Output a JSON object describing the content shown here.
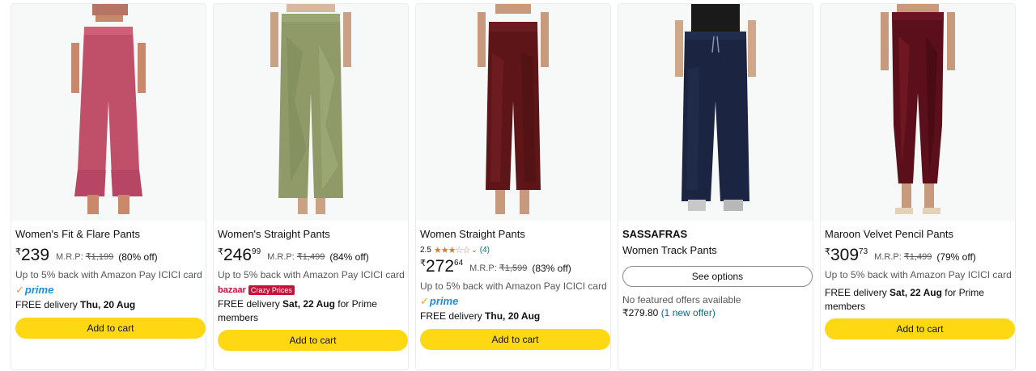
{
  "products": [
    {
      "title": "Women's Fit & Flare Pants",
      "price_symbol": "₹",
      "price_whole": "239",
      "price_fraction": "",
      "mrp_label": "M.R.P:",
      "mrp_value": "₹1,199",
      "discount": "(80% off)",
      "cashback": "Up to 5% back with Amazon Pay ICICI card",
      "prime_label": "prime",
      "delivery_prefix": "FREE delivery",
      "delivery_date": "Thu, 20 Aug",
      "button_label": "Add to cart"
    },
    {
      "title": "Women's Straight Pants",
      "price_symbol": "₹",
      "price_whole": "246",
      "price_fraction": "99",
      "mrp_label": "M.R.P:",
      "mrp_value": "₹1,499",
      "discount": "(84% off)",
      "cashback": "Up to 5% back with Amazon Pay ICICI card",
      "bazaar_label": "bazaar",
      "badge_label": "Crazy Prices",
      "delivery_prefix": "FREE delivery",
      "delivery_date": "Sat, 22 Aug",
      "delivery_suffix": "for Prime members",
      "button_label": "Add to cart"
    },
    {
      "title": "Women Straight Pants",
      "rating_value": "2.5",
      "rating_stars": "★★★☆☆",
      "rating_count": "(4)",
      "price_symbol": "₹",
      "price_whole": "272",
      "price_fraction": "64",
      "mrp_label": "M.R.P:",
      "mrp_value": "₹1,599",
      "discount": "(83% off)",
      "cashback": "Up to 5% back with Amazon Pay ICICI card",
      "prime_label": "prime",
      "delivery_prefix": "FREE delivery",
      "delivery_date": "Thu, 20 Aug",
      "button_label": "Add to cart"
    },
    {
      "brand": "SASSAFRAS",
      "title": "Women Track Pants",
      "button_label": "See options",
      "no_offers": "No featured offers available",
      "offer_price": "₹279.80",
      "offer_link": "(1 new offer)"
    },
    {
      "title": "Maroon Velvet Pencil Pants",
      "price_symbol": "₹",
      "price_whole": "309",
      "price_fraction": "73",
      "mrp_label": "M.R.P:",
      "mrp_value": "₹1,499",
      "discount": "(79% off)",
      "cashback": "Up to 5% back with Amazon Pay ICICI card",
      "delivery_prefix": "FREE delivery",
      "delivery_date": "Sat, 22 Aug",
      "delivery_suffix": "for Prime members",
      "button_label": "Add to cart"
    }
  ],
  "colors": {
    "button_yellow": "#ffd814",
    "prime_blue": "#1f8ed8",
    "link_teal": "#007185",
    "star_orange": "#de7921",
    "bazaar_red": "#cc0c39",
    "pants_1": "#c0506a",
    "pants_2": "#8f9a68",
    "pants_3": "#5e1518",
    "pants_4": "#1b2440",
    "pants_5": "#5a0f1a"
  }
}
